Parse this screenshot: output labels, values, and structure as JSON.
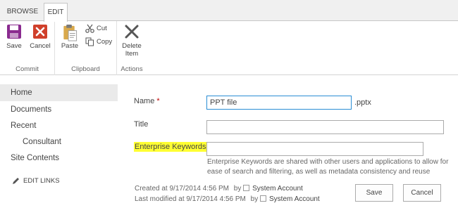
{
  "tabs": [
    {
      "label": "BROWSE"
    },
    {
      "label": "EDIT"
    }
  ],
  "ribbon": {
    "commit": {
      "label": "Commit",
      "save": "Save",
      "cancel": "Cancel"
    },
    "clipboard": {
      "label": "Clipboard",
      "paste": "Paste",
      "cut": "Cut",
      "copy": "Copy"
    },
    "actions": {
      "label": "Actions",
      "delete_line1": "Delete",
      "delete_line2": "Item"
    }
  },
  "nav": {
    "home": "Home",
    "documents": "Documents",
    "recent": "Recent",
    "consultant": "Consultant",
    "site_contents": "Site Contents",
    "edit_links": "EDIT LINKS"
  },
  "form": {
    "name_label": "Name",
    "required_mark": "*",
    "name_value": "PPT file",
    "name_suffix": ".pptx",
    "title_label": "Title",
    "title_value": "",
    "keywords_label": "Enterprise Keywords",
    "keywords_value": "",
    "keywords_hint": "Enterprise Keywords are shared with other users and applications to allow for ease of search and filtering, as well as metadata consistency and reuse"
  },
  "meta": {
    "created_text": "Created at 9/17/2014 4:56 PM",
    "modified_text": "Last modified at 9/17/2014 4:56 PM",
    "by": "by",
    "account": "System Account"
  },
  "buttons": {
    "save": "Save",
    "cancel": "Cancel"
  },
  "colors": {
    "save_icon": "#8a2b8f",
    "cancel_icon": "#d0402b",
    "delete_icon": "#555555",
    "highlight": "#ffff33",
    "focus_border": "#2a8dd4",
    "required": "#bf0000"
  }
}
